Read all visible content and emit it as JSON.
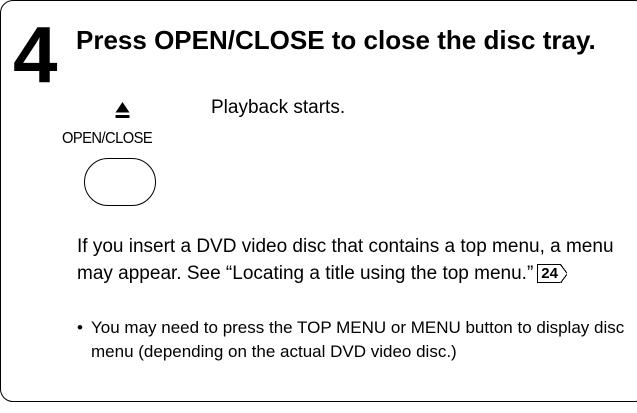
{
  "step": {
    "number": "4",
    "title": "Press OPEN/CLOSE to close the disc tray."
  },
  "button": {
    "icon": "eject-icon",
    "label": "OPEN/CLOSE"
  },
  "result_text": "Playback starts.",
  "paragraph": {
    "text": "If you insert a DVD video disc that contains a top menu, a menu may appear. See “Locating a title using the top menu.”",
    "page_ref": "24"
  },
  "notes": [
    "You may need to press the TOP MENU or MENU button to display disc menu (depending on the actual DVD video disc.)"
  ]
}
